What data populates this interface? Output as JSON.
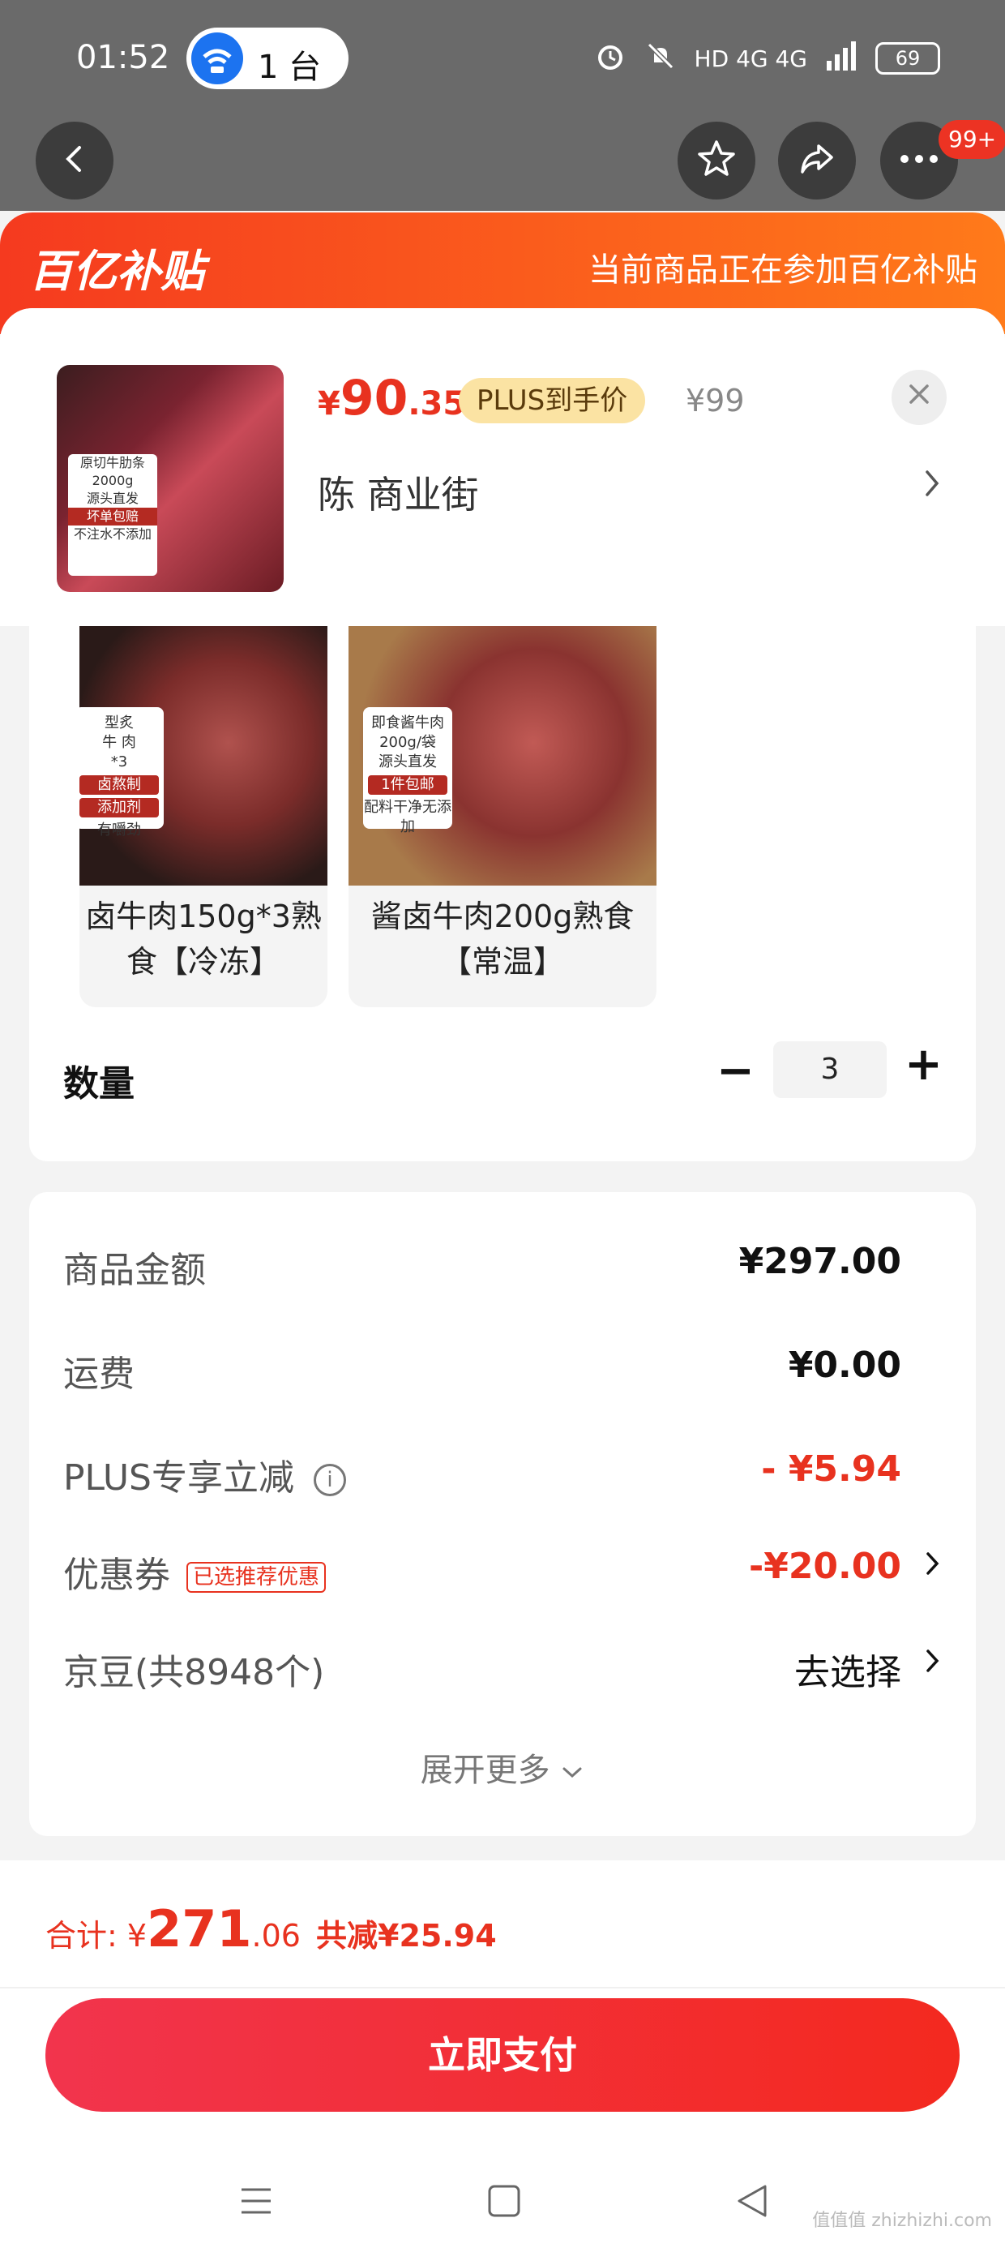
{
  "status_bar": {
    "time": "01:52",
    "device_count": "1 台",
    "network": "HD 4G 4G",
    "battery": "69"
  },
  "nav": {
    "message_badge": "99+"
  },
  "banner": {
    "logo": "百亿补贴",
    "notice": "当前商品正在参加百亿补贴"
  },
  "product": {
    "price_symbol": "¥",
    "price_int": "90",
    "price_dec": ".35",
    "plus_tag": "PLUS到手价",
    "original_price": "¥99",
    "address": "陈  商业街",
    "image_label_lines": [
      "原切牛肋条",
      "2000g",
      "源头直发",
      "坏单包赔",
      "不注水不添加"
    ]
  },
  "variants": [
    {
      "name": "卤牛肉150g*3熟食【冷冻】",
      "tag_lines": [
        "型炙",
        "牛 肉",
        "*3",
        "卤熬制",
        "添加剂",
        "有嚼劲"
      ]
    },
    {
      "name": "酱卤牛肉200g熟食【常温】",
      "tag_lines": [
        "即食酱牛肉",
        "200g/袋",
        "源头直发",
        "1件包邮",
        "配料干净无添加"
      ]
    }
  ],
  "quantity": {
    "label": "数量",
    "value": "3",
    "minus": "−",
    "plus": "+"
  },
  "costs": {
    "goods_amount_label": "商品金额",
    "goods_amount": "¥297.00",
    "shipping_label": "运费",
    "shipping": "¥0.00",
    "plus_discount_label": "PLUS专享立减",
    "plus_discount": "- ¥5.94",
    "coupon_label": "优惠券",
    "coupon_tag": "已选推荐优惠",
    "coupon_value": "-¥20.00",
    "jingdou_label": "京豆(共8948个)",
    "jingdou_value": "去选择",
    "expand": "展开更多"
  },
  "footer": {
    "total_prefix": "合计: ¥",
    "total_int": "271",
    "total_dec": ".06",
    "saving": "共减¥25.94",
    "pay_button": "立即支付"
  },
  "watermark": "值值值 zhizhizhi.com"
}
